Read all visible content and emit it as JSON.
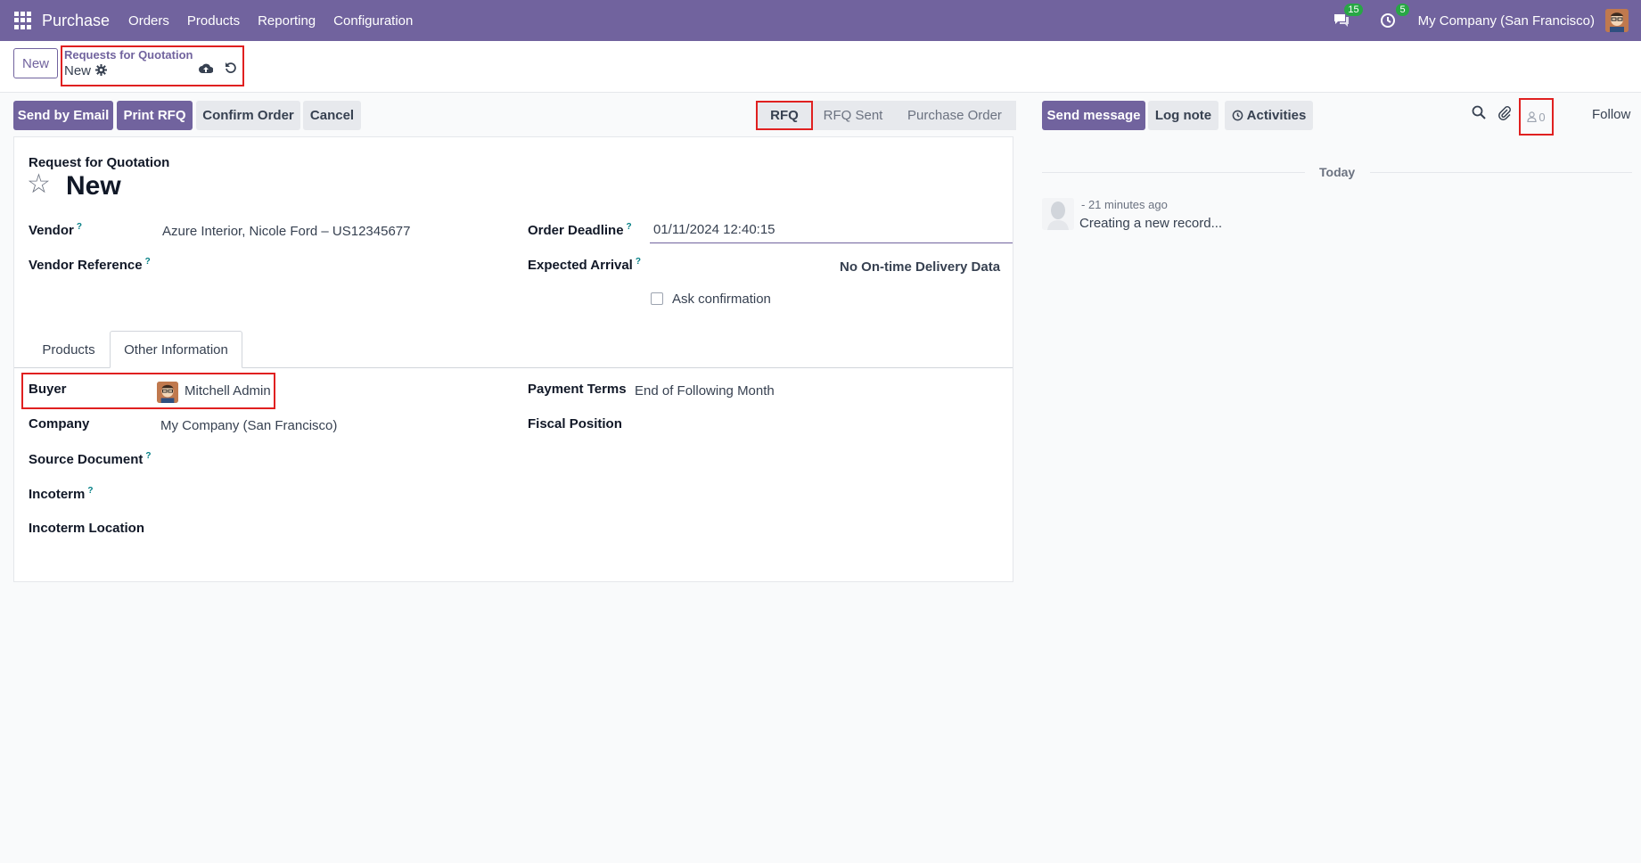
{
  "topnav": {
    "app_name": "Purchase",
    "menu": [
      "Orders",
      "Products",
      "Reporting",
      "Configuration"
    ],
    "messages_count": "15",
    "activities_count": "5",
    "company": "My Company (San Francisco)"
  },
  "control_panel": {
    "new_label": "New",
    "breadcrumb_parent": "Requests for Quotation",
    "breadcrumb_current": "New"
  },
  "actions": {
    "send_email": "Send by Email",
    "print_rfq": "Print RFQ",
    "confirm_order": "Confirm Order",
    "cancel": "Cancel"
  },
  "statusbar": {
    "stages": [
      "RFQ",
      "RFQ Sent",
      "Purchase Order"
    ],
    "active": "RFQ"
  },
  "form": {
    "subtitle": "Request for Quotation",
    "title": "New",
    "vendor_label": "Vendor",
    "vendor_value": "Azure Interior, Nicole Ford – US12345677",
    "vendor_ref_label": "Vendor Reference",
    "order_deadline_label": "Order Deadline",
    "order_deadline_value": "01/11/2024 12:40:15",
    "expected_arrival_label": "Expected Arrival",
    "on_time_delivery": "No On-time Delivery Data",
    "ask_confirmation_label": "Ask confirmation",
    "help_mark": "?"
  },
  "tabs": [
    "Products",
    "Other Information"
  ],
  "other_info": {
    "buyer_label": "Buyer",
    "buyer_value": "Mitchell Admin",
    "company_label": "Company",
    "company_value": "My Company (San Francisco)",
    "source_doc_label": "Source Document",
    "incoterm_label": "Incoterm",
    "incoterm_location_label": "Incoterm Location",
    "payment_terms_label": "Payment Terms",
    "payment_terms_value": "End of Following Month",
    "fiscal_position_label": "Fiscal Position"
  },
  "chatter": {
    "send_message": "Send message",
    "log_note": "Log note",
    "activities": "Activities",
    "followers_count": "0",
    "follow": "Follow",
    "today": "Today",
    "message_date": "- 21 minutes ago",
    "message_body": "Creating a new record..."
  },
  "colors": {
    "brand": "#71639e",
    "highlight_border": "#e02020",
    "badge": "#28a745",
    "help": "#017e84"
  }
}
